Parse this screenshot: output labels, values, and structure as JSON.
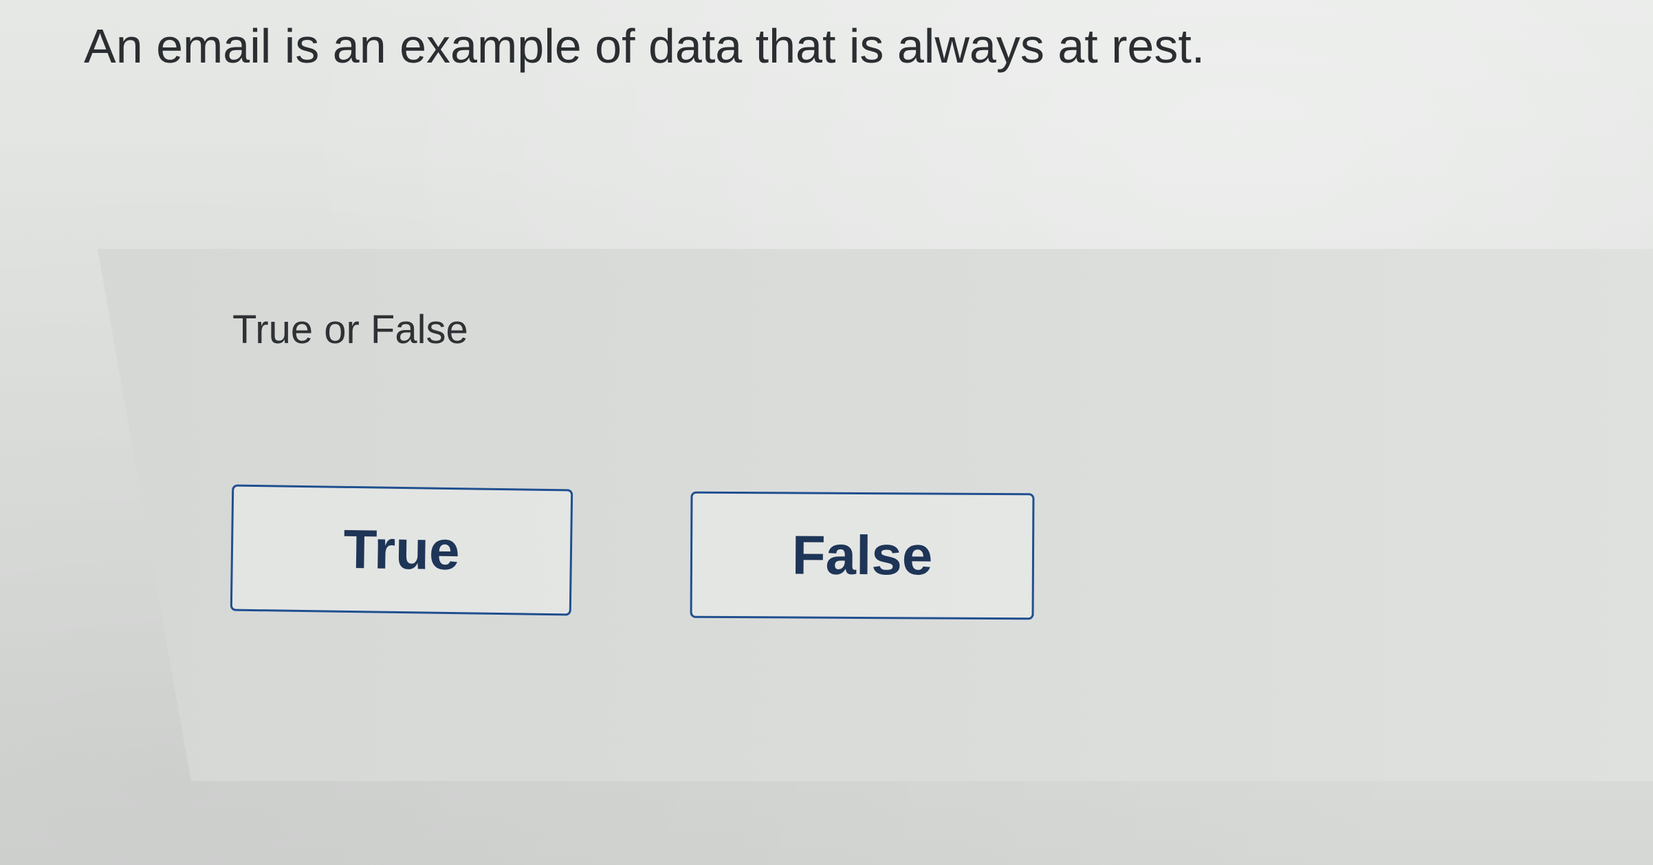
{
  "question": {
    "text": "An email is an example of data that is always at rest."
  },
  "answer_area": {
    "prompt": "True or False",
    "choices": [
      {
        "label": "True"
      },
      {
        "label": "False"
      }
    ]
  },
  "colors": {
    "button_border": "#1f4f8f",
    "button_text": "#1e3557",
    "question_text": "#2b2e31",
    "background": "#e1e3e1"
  }
}
